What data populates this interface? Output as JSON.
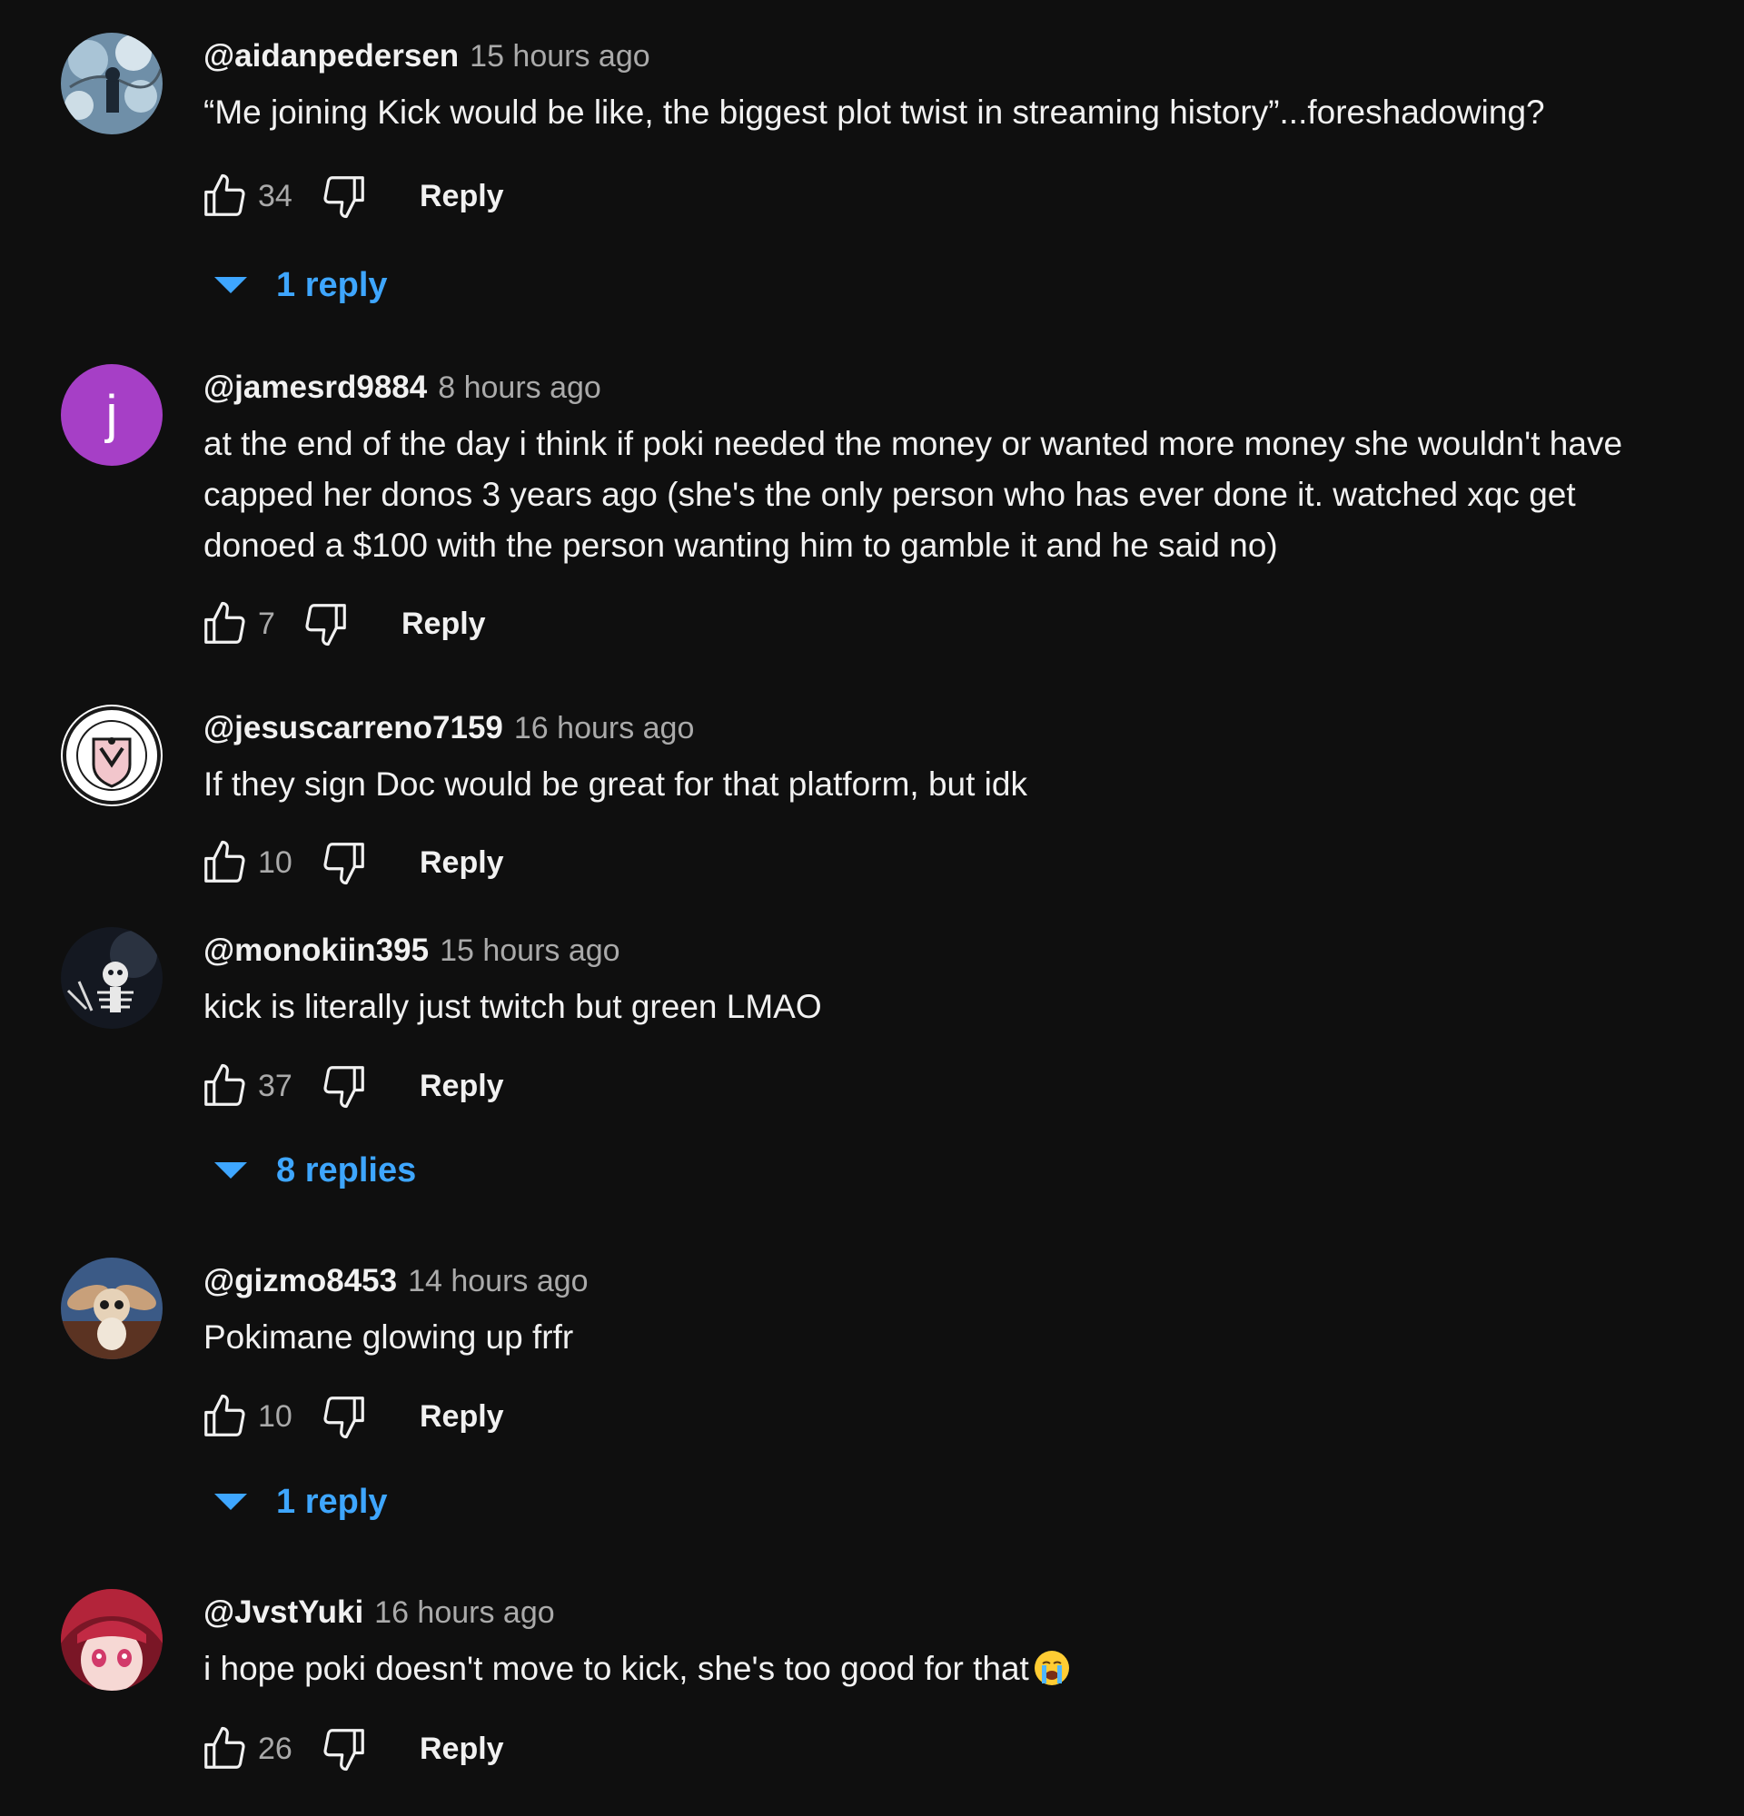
{
  "comments": [
    {
      "author": "@aidanpedersen",
      "time": "15 hours ago",
      "text": "“Me joining Kick would be like, the biggest plot twist in streaming history”...foreshadowing?",
      "likes": "34",
      "reply_label": "Reply",
      "replies_label": "1 reply"
    },
    {
      "author": "@jamesrd9884",
      "avatar_letter": "j",
      "time": "8 hours ago",
      "text": "at the end of the day i think if poki needed the money or wanted more money she wouldn't have capped her donos 3 years ago (she's the only person who has ever done it. watched xqc get donoed a $100 with the person wanting him to gamble it and he said no)",
      "likes": "7",
      "reply_label": "Reply"
    },
    {
      "author": "@jesuscarreno7159",
      "time": "16 hours ago",
      "text": "If they sign Doc would be great for that platform, but idk",
      "likes": "10",
      "reply_label": "Reply"
    },
    {
      "author": "@monokiin395",
      "time": "15 hours ago",
      "text": "kick is literally just twitch but green LMAO",
      "likes": "37",
      "reply_label": "Reply",
      "replies_label": "8 replies"
    },
    {
      "author": "@gizmo8453",
      "time": "14 hours ago",
      "text": "Pokimane glowing up frfr",
      "likes": "10",
      "reply_label": "Reply",
      "replies_label": "1 reply"
    },
    {
      "author": "@JvstYuki",
      "time": "16 hours ago",
      "text": "i hope poki doesn't move to kick, she's too good for that",
      "emoji": "loudly-crying-face",
      "likes": "26",
      "reply_label": "Reply"
    }
  ],
  "icons": {
    "like": "thumbs-up-icon",
    "dislike": "thumbs-down-icon",
    "expand": "caret-down-icon"
  },
  "colors": {
    "background": "#0f0f0f",
    "text": "#f1f1f1",
    "secondary_text": "#aaaaaa",
    "link_blue": "#3ea6ff",
    "letter_avatar": "#a63fc6"
  }
}
